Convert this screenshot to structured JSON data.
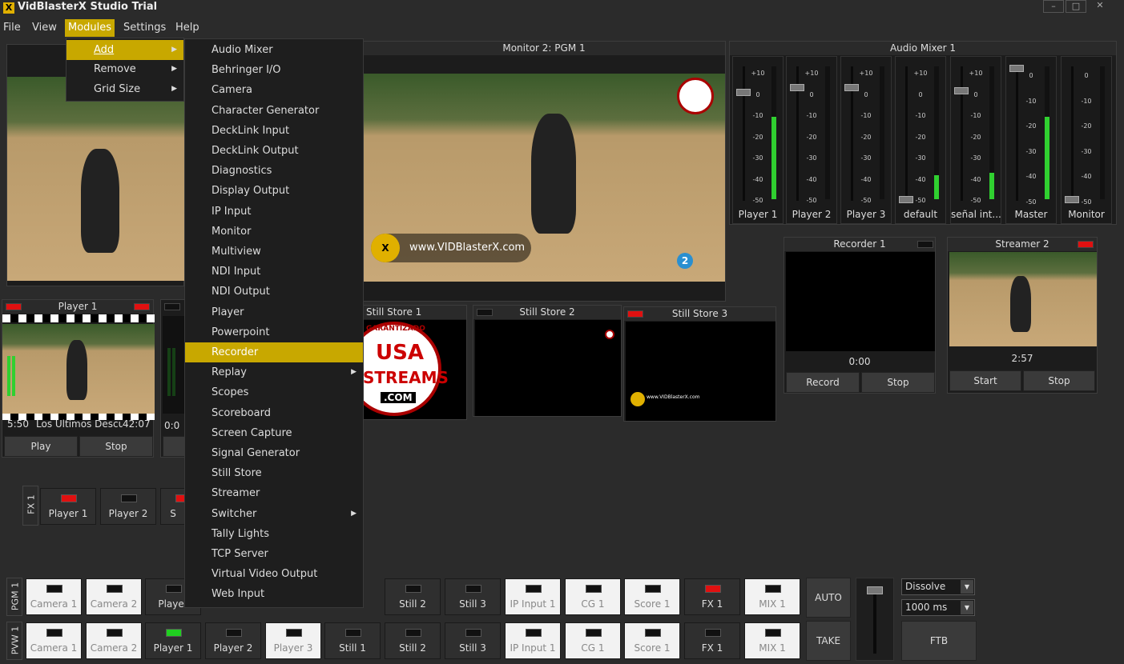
{
  "app": {
    "title": "VidBlasterX Studio Trial",
    "icon": "X"
  },
  "window_controls": [
    "–",
    "□",
    "✕"
  ],
  "menubar": [
    "File",
    "View",
    "Modules",
    "Settings",
    "Help"
  ],
  "modules_menu": [
    {
      "label": "Add",
      "submenu": true
    },
    {
      "label": "Remove",
      "submenu": true
    },
    {
      "label": "Grid Size",
      "submenu": true
    }
  ],
  "add_menu": [
    {
      "label": "Audio Mixer"
    },
    {
      "label": "Behringer I/O"
    },
    {
      "label": "Camera"
    },
    {
      "label": "Character Generator"
    },
    {
      "label": "DeckLink Input"
    },
    {
      "label": "DeckLink Output"
    },
    {
      "label": "Diagnostics"
    },
    {
      "label": "Display Output"
    },
    {
      "label": "IP Input"
    },
    {
      "label": "Monitor"
    },
    {
      "label": "Multiview"
    },
    {
      "label": "NDI Input"
    },
    {
      "label": "NDI Output"
    },
    {
      "label": "Player"
    },
    {
      "label": "Powerpoint"
    },
    {
      "label": "Recorder"
    },
    {
      "label": "Replay",
      "submenu": true
    },
    {
      "label": "Scopes"
    },
    {
      "label": "Scoreboard"
    },
    {
      "label": "Screen Capture"
    },
    {
      "label": "Signal Generator"
    },
    {
      "label": "Still Store"
    },
    {
      "label": "Streamer"
    },
    {
      "label": "Switcher",
      "submenu": true
    },
    {
      "label": "Tally Lights"
    },
    {
      "label": "TCP Server"
    },
    {
      "label": "Virtual Video Output"
    },
    {
      "label": "Web Input"
    }
  ],
  "monitor2": {
    "title": "Monitor 2: PGM 1",
    "watermark": "www.VIDBlasterX.com",
    "badge": "2"
  },
  "audio_mixer": {
    "title": "Audio Mixer 1",
    "scale": [
      "+10",
      "0",
      "-10",
      "-20",
      "-30",
      "-40",
      "-50"
    ],
    "master_scale": [
      "0",
      "-10",
      "-20",
      "-30",
      "-40",
      "-50"
    ],
    "channels": [
      {
        "name": "Player 1",
        "level": 0.62
      },
      {
        "name": "Player 2",
        "level": 0.0
      },
      {
        "name": "Player 3",
        "level": 0.0
      },
      {
        "name": "default",
        "level": 0.18
      },
      {
        "name": "señal int...",
        "level": 0.2
      },
      {
        "name": "Master",
        "level": 0.62
      },
      {
        "name": "Monitor",
        "level": 0.0
      }
    ]
  },
  "player1": {
    "title": "Player 1",
    "time_left": "5:50",
    "clip": "Los Ultimos Descut",
    "duration": "42:07",
    "play": "Play",
    "stop": "Stop"
  },
  "player2_stub": {
    "time": "0:0"
  },
  "still_stores": [
    {
      "title": "Still Store 1",
      "logo_lines": [
        "GARANTIZADO",
        "USA",
        "STREAMS",
        ".COM"
      ]
    },
    {
      "title": "Still Store 2"
    },
    {
      "title": "Still Store 3",
      "text": "www.VIDBlasterX.com"
    }
  ],
  "recorder1": {
    "title": "Recorder 1",
    "time": "0:00",
    "record": "Record",
    "stop": "Stop"
  },
  "streamer2": {
    "title": "Streamer 2",
    "time": "2:57",
    "start": "Start",
    "stop": "Stop"
  },
  "fx1": {
    "label": "FX 1",
    "buttons": [
      {
        "label": "Player 1",
        "tally": "red"
      },
      {
        "label": "Player 2",
        "tally": "off"
      },
      {
        "label": "S",
        "tally": "red"
      }
    ]
  },
  "switcher": {
    "pgm_label": "PGM 1",
    "pvw_label": "PVW 1",
    "pgm": [
      {
        "label": "Camera 1",
        "light": true,
        "tally": "off"
      },
      {
        "label": "Camera 2",
        "light": true,
        "tally": "off"
      },
      {
        "label": "Player",
        "light": false,
        "tally": "off"
      },
      {
        "label": "Still 2",
        "light": false,
        "tally": "off"
      },
      {
        "label": "Still 3",
        "light": false,
        "tally": "off"
      },
      {
        "label": "IP Input 1",
        "light": true,
        "tally": "off"
      },
      {
        "label": "CG 1",
        "light": true,
        "tally": "off"
      },
      {
        "label": "Score 1",
        "light": true,
        "tally": "off"
      },
      {
        "label": "FX 1",
        "light": false,
        "tally": "red"
      },
      {
        "label": "MIX 1",
        "light": true,
        "tally": "off"
      }
    ],
    "pvw": [
      {
        "label": "Camera 1",
        "light": true,
        "tally": "off"
      },
      {
        "label": "Camera 2",
        "light": true,
        "tally": "off"
      },
      {
        "label": "Player 1",
        "light": false,
        "tally": "green"
      },
      {
        "label": "Player 2",
        "light": false,
        "tally": "off"
      },
      {
        "label": "Player 3",
        "light": true,
        "tally": "off"
      },
      {
        "label": "Still 1",
        "light": false,
        "tally": "off"
      },
      {
        "label": "Still 2",
        "light": false,
        "tally": "off"
      },
      {
        "label": "Still 3",
        "light": false,
        "tally": "off"
      },
      {
        "label": "IP Input 1",
        "light": true,
        "tally": "off"
      },
      {
        "label": "CG 1",
        "light": true,
        "tally": "off"
      },
      {
        "label": "Score 1",
        "light": true,
        "tally": "off"
      },
      {
        "label": "FX 1",
        "light": false,
        "tally": "off"
      },
      {
        "label": "MIX 1",
        "light": true,
        "tally": "off"
      }
    ],
    "auto": "AUTO",
    "take": "TAKE",
    "ftb": "FTB",
    "transition": "Dissolve",
    "duration": "1000 ms"
  }
}
